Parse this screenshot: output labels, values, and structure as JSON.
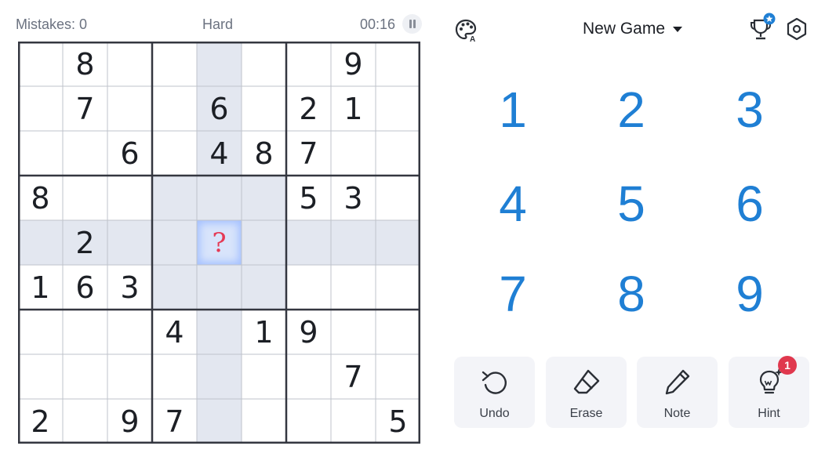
{
  "header": {
    "mistakes_label": "Mistakes: 0",
    "difficulty": "Hard",
    "timer": "00:16"
  },
  "board": {
    "grid": [
      [
        "",
        "8",
        "",
        "",
        "",
        "",
        "",
        "9",
        ""
      ],
      [
        "",
        "7",
        "",
        "",
        "6",
        "",
        "2",
        "1",
        ""
      ],
      [
        "",
        "",
        "6",
        "",
        "4",
        "8",
        "7",
        "",
        ""
      ],
      [
        "8",
        "",
        "",
        "",
        "",
        "",
        "5",
        "3",
        ""
      ],
      [
        "",
        "2",
        "",
        "",
        "?",
        "",
        "",
        "",
        ""
      ],
      [
        "1",
        "6",
        "3",
        "",
        "",
        "",
        "",
        "",
        ""
      ],
      [
        "",
        "",
        "",
        "4",
        "",
        "1",
        "9",
        "",
        ""
      ],
      [
        "",
        "",
        "",
        "",
        "",
        "",
        "",
        "7",
        ""
      ],
      [
        "2",
        "",
        "9",
        "7",
        "",
        "",
        "",
        "",
        "5"
      ]
    ],
    "selected_cell": {
      "row": 4,
      "col": 4
    }
  },
  "top_bar": {
    "new_game_label": "New Game",
    "icons": [
      "palette-icon",
      "trophy-icon",
      "settings-icon"
    ]
  },
  "number_pad": [
    "1",
    "2",
    "3",
    "4",
    "5",
    "6",
    "7",
    "8",
    "9"
  ],
  "actions": [
    {
      "label": "Undo",
      "icon": "undo-icon"
    },
    {
      "label": "Erase",
      "icon": "eraser-icon"
    },
    {
      "label": "Note",
      "icon": "pencil-icon"
    },
    {
      "label": "Hint",
      "icon": "lightbulb-icon"
    }
  ],
  "hint_count": "1",
  "colors": {
    "accent_number": "#1f7fd4",
    "highlight": "#e3e7f0",
    "selected": "#d8e4fb",
    "badge": "#e0384e",
    "question_mark": "#e53955"
  }
}
